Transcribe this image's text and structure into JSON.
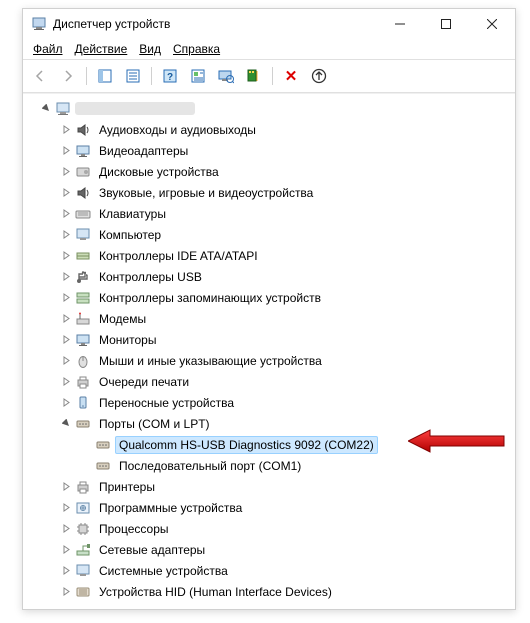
{
  "window": {
    "title": "Диспетчер устройств"
  },
  "menu": {
    "file": "Файл",
    "action": "Действие",
    "view": "Вид",
    "help": "Справка"
  },
  "tree": {
    "root": "",
    "categories": [
      {
        "label": "Аудиовходы и аудиовыходы",
        "icon": "speaker"
      },
      {
        "label": "Видеоадаптеры",
        "icon": "display"
      },
      {
        "label": "Дисковые устройства",
        "icon": "disk"
      },
      {
        "label": "Звуковые, игровые и видеоустройства",
        "icon": "speaker"
      },
      {
        "label": "Клавиатуры",
        "icon": "keyboard"
      },
      {
        "label": "Компьютер",
        "icon": "desktop"
      },
      {
        "label": "Контроллеры IDE ATA/ATAPI",
        "icon": "ide"
      },
      {
        "label": "Контроллеры USB",
        "icon": "usb"
      },
      {
        "label": "Контроллеры запоминающих устройств",
        "icon": "storage"
      },
      {
        "label": "Модемы",
        "icon": "modem"
      },
      {
        "label": "Мониторы",
        "icon": "display"
      },
      {
        "label": "Мыши и иные указывающие устройства",
        "icon": "mouse"
      },
      {
        "label": "Очереди печати",
        "icon": "printer"
      },
      {
        "label": "Переносные устройства",
        "icon": "portable"
      },
      {
        "label": "Порты (COM и LPT)",
        "icon": "port",
        "expanded": true,
        "children": [
          {
            "label": "Qualcomm HS-USB Diagnostics 9092 (COM22)",
            "icon": "port",
            "selected": true
          },
          {
            "label": "Последовательный порт (COM1)",
            "icon": "port"
          }
        ]
      },
      {
        "label": "Принтеры",
        "icon": "printer"
      },
      {
        "label": "Программные устройства",
        "icon": "software"
      },
      {
        "label": "Процессоры",
        "icon": "cpu"
      },
      {
        "label": "Сетевые адаптеры",
        "icon": "network"
      },
      {
        "label": "Системные устройства",
        "icon": "desktop"
      },
      {
        "label": "Устройства HID (Human Interface Devices)",
        "icon": "hid"
      }
    ]
  },
  "annotation": {
    "arrow_color": "#e30000"
  }
}
